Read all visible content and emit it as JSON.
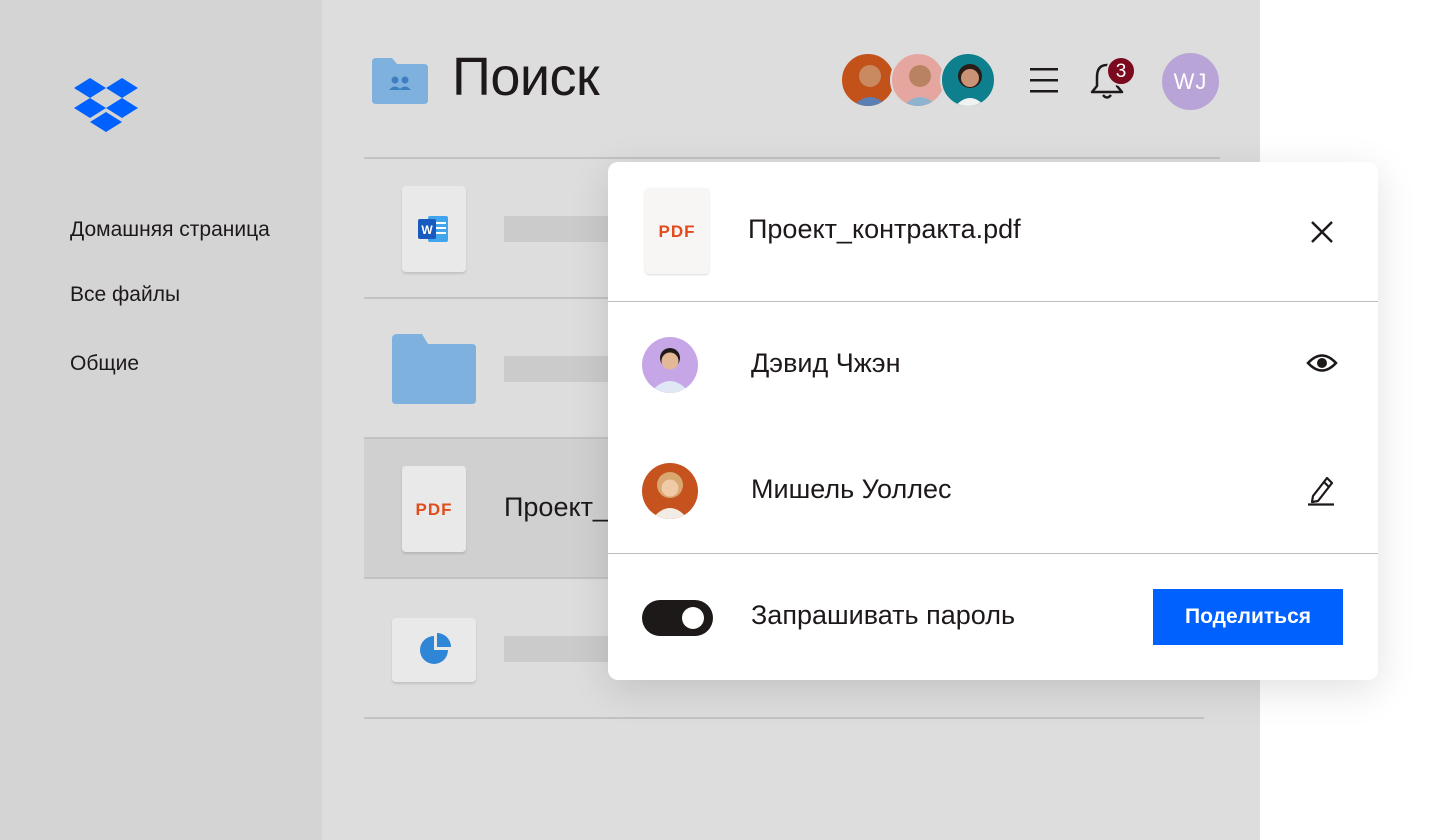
{
  "sidebar": {
    "logo_name": "dropbox-logo",
    "items": [
      {
        "label": "Домашняя страница"
      },
      {
        "label": "Все файлы"
      },
      {
        "label": "Общие"
      }
    ]
  },
  "header": {
    "title": "Поиск",
    "notification_count": "3",
    "user_initials": "WJ"
  },
  "files": [
    {
      "icon": "word-icon",
      "name": ""
    },
    {
      "icon": "folder-icon",
      "name": ""
    },
    {
      "icon": "pdf-icon",
      "name": "Проект_",
      "tile_label": "PDF"
    },
    {
      "icon": "pie-chart-icon",
      "name": ""
    }
  ],
  "share_dialog": {
    "file_tile_label": "PDF",
    "file_name": "Проект_контракта.pdf",
    "people": [
      {
        "name": "Дэвид Чжэн",
        "permission_icon": "eye-icon"
      },
      {
        "name": "Мишель Уоллес",
        "permission_icon": "pencil-icon"
      }
    ],
    "password_toggle_label": "Запрашивать пароль",
    "password_toggle_on": true,
    "share_button_label": "Поделиться"
  },
  "colors": {
    "accent": "#0061fe",
    "badge": "#7b0a1f",
    "pdf": "#e24c1c"
  }
}
